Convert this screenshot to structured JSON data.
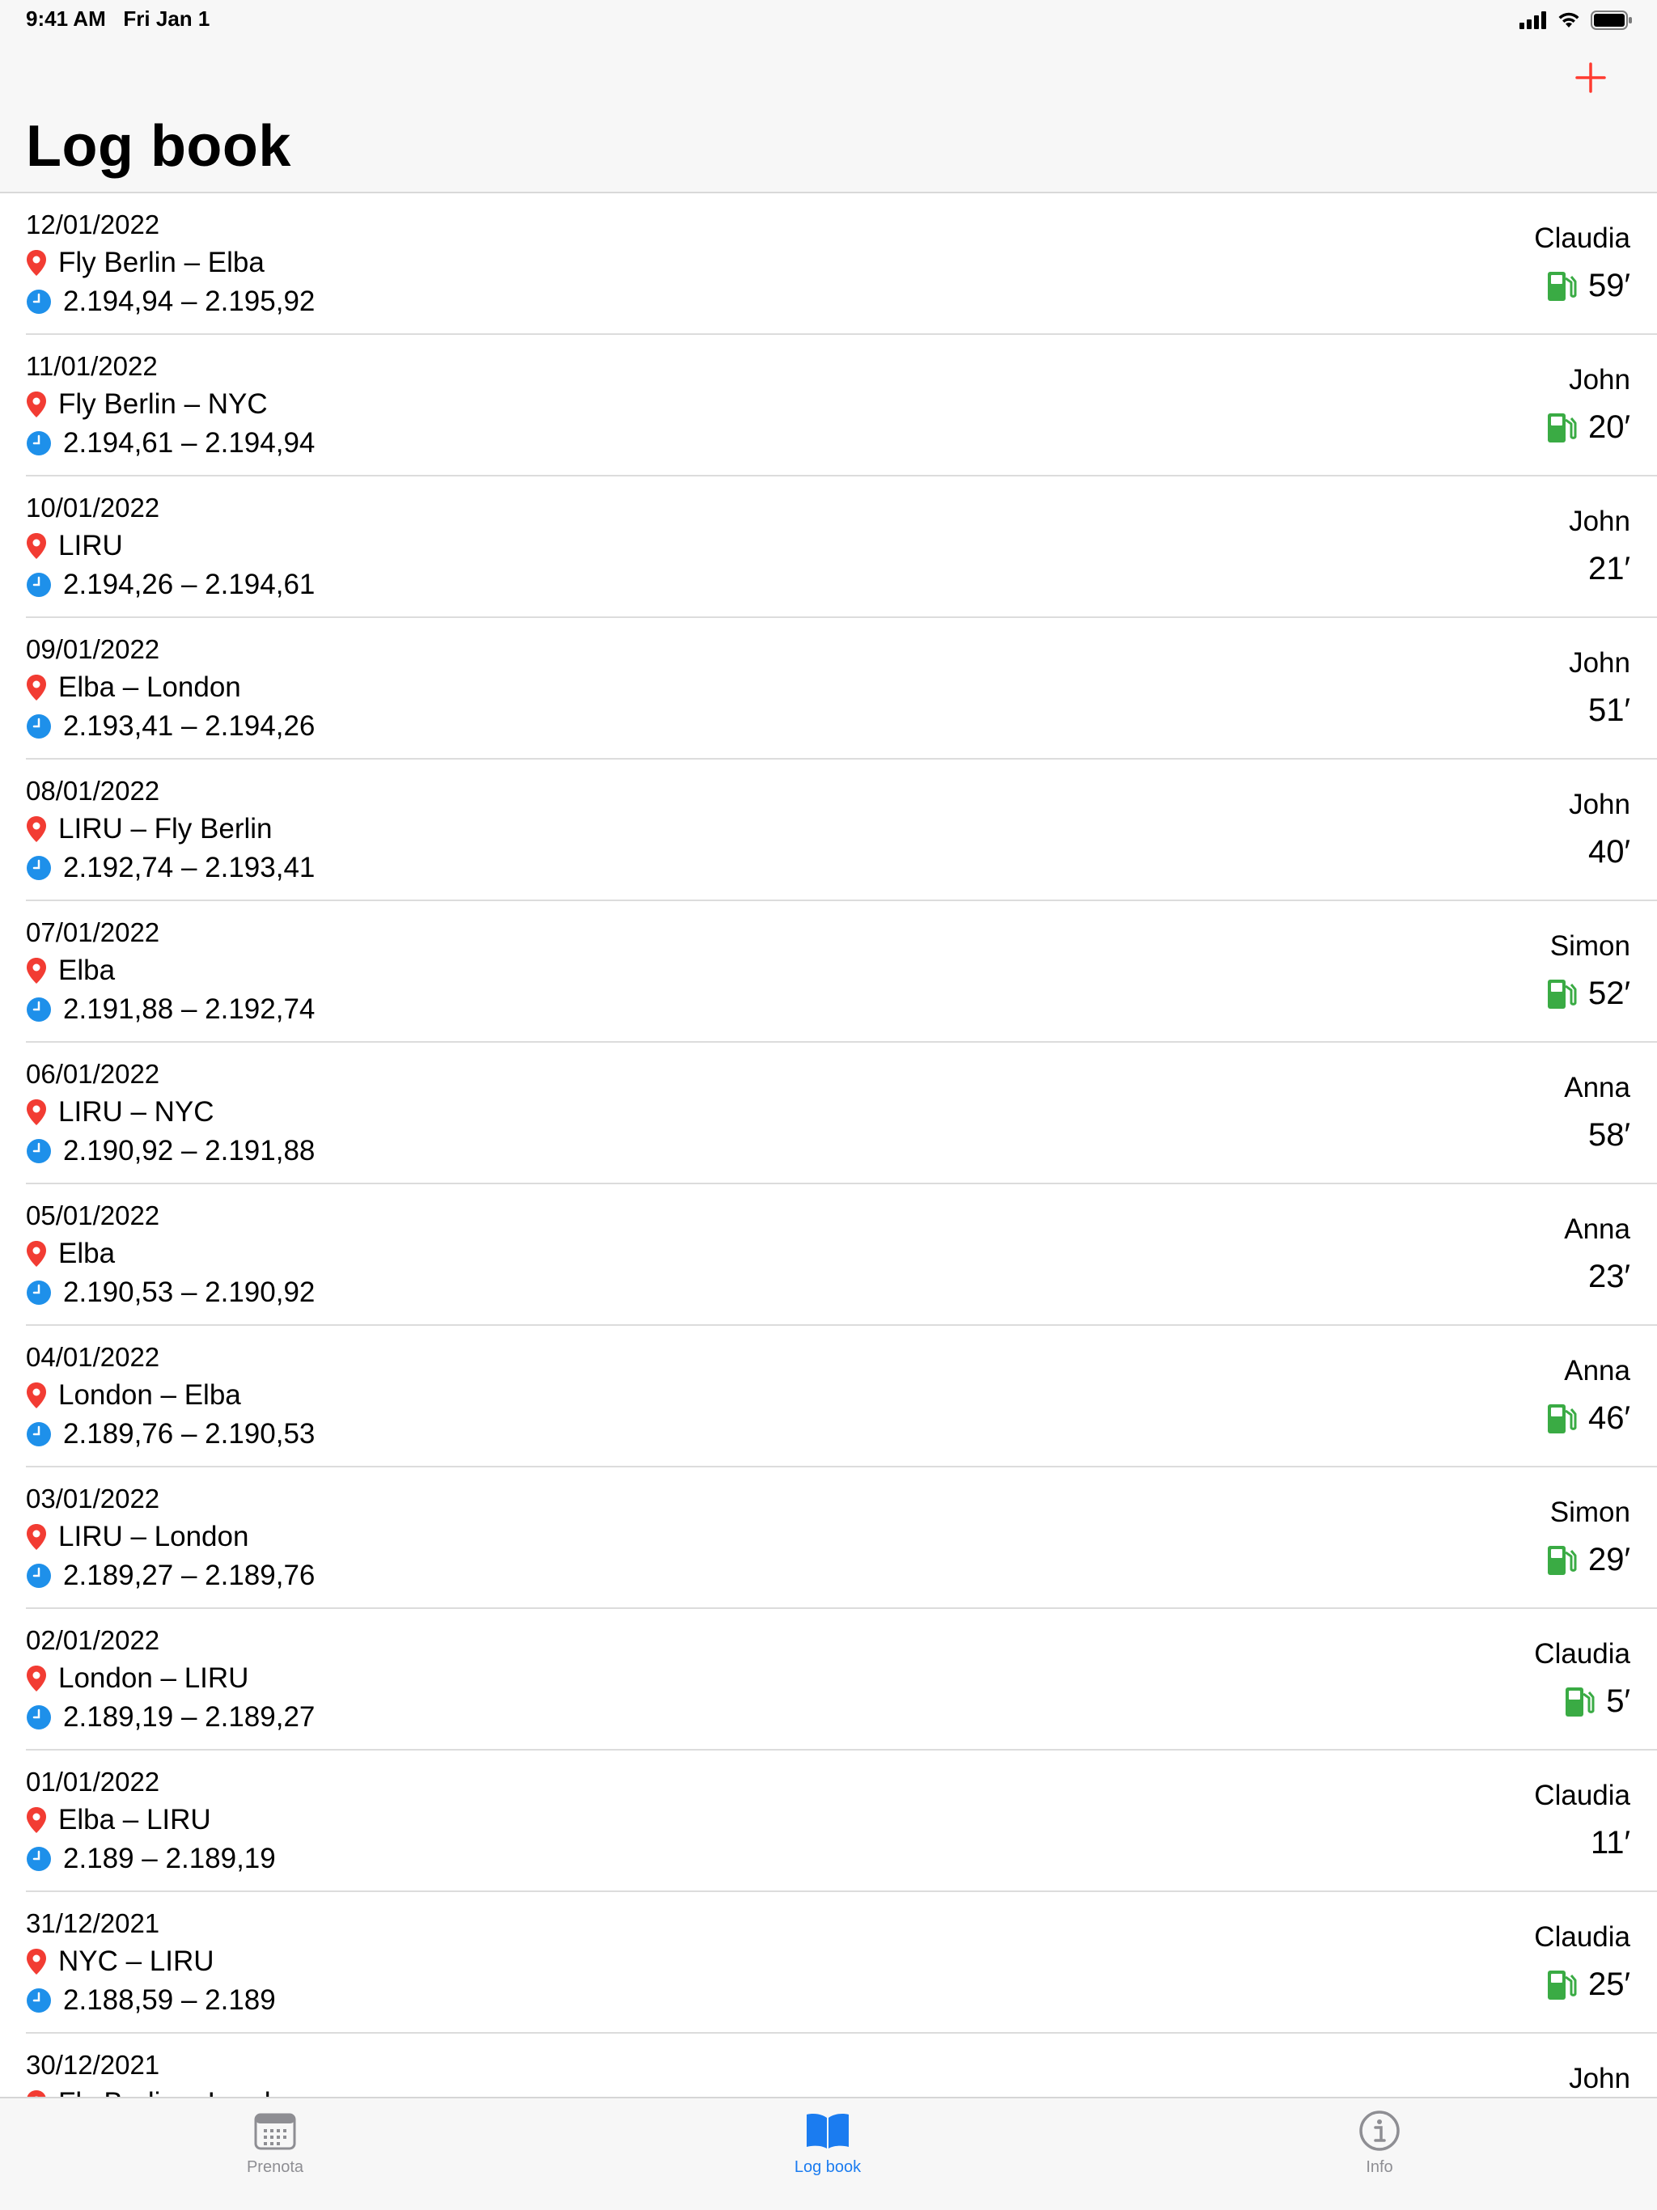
{
  "status_bar": {
    "time": "9:41 AM",
    "date": "Fri Jan 1"
  },
  "header": {
    "title": "Log book"
  },
  "colors": {
    "accent": "#1b7cf0",
    "add": "#ff3b30",
    "pin": "#f23c33",
    "clock": "#1e90ea",
    "fuel": "#3aab44"
  },
  "entries": [
    {
      "date": "12/01/2022",
      "route": "Fly Berlin – Elba",
      "hours": "2.194,94 – 2.195,92",
      "pilot": "Claudia",
      "duration": "59′",
      "fuel": true
    },
    {
      "date": "11/01/2022",
      "route": "Fly Berlin – NYC",
      "hours": "2.194,61 – 2.194,94",
      "pilot": "John",
      "duration": "20′",
      "fuel": true
    },
    {
      "date": "10/01/2022",
      "route": "LIRU",
      "hours": "2.194,26 – 2.194,61",
      "pilot": "John",
      "duration": "21′",
      "fuel": false
    },
    {
      "date": "09/01/2022",
      "route": "Elba – London",
      "hours": "2.193,41 – 2.194,26",
      "pilot": "John",
      "duration": "51′",
      "fuel": false
    },
    {
      "date": "08/01/2022",
      "route": "LIRU – Fly Berlin",
      "hours": "2.192,74 – 2.193,41",
      "pilot": "John",
      "duration": "40′",
      "fuel": false
    },
    {
      "date": "07/01/2022",
      "route": "Elba",
      "hours": "2.191,88 – 2.192,74",
      "pilot": "Simon",
      "duration": "52′",
      "fuel": true
    },
    {
      "date": "06/01/2022",
      "route": "LIRU – NYC",
      "hours": "2.190,92 – 2.191,88",
      "pilot": "Anna",
      "duration": "58′",
      "fuel": false
    },
    {
      "date": "05/01/2022",
      "route": "Elba",
      "hours": "2.190,53 – 2.190,92",
      "pilot": "Anna",
      "duration": "23′",
      "fuel": false
    },
    {
      "date": "04/01/2022",
      "route": "London – Elba",
      "hours": "2.189,76 – 2.190,53",
      "pilot": "Anna",
      "duration": "46′",
      "fuel": true
    },
    {
      "date": "03/01/2022",
      "route": "LIRU – London",
      "hours": "2.189,27 – 2.189,76",
      "pilot": "Simon",
      "duration": "29′",
      "fuel": true
    },
    {
      "date": "02/01/2022",
      "route": "London – LIRU",
      "hours": "2.189,19 – 2.189,27",
      "pilot": "Claudia",
      "duration": "5′",
      "fuel": true
    },
    {
      "date": "01/01/2022",
      "route": "Elba – LIRU",
      "hours": "2.189 – 2.189,19",
      "pilot": "Claudia",
      "duration": "11′",
      "fuel": false
    },
    {
      "date": "31/12/2021",
      "route": "NYC – LIRU",
      "hours": "2.188,59 – 2.189",
      "pilot": "Claudia",
      "duration": "25′",
      "fuel": true
    },
    {
      "date": "30/12/2021",
      "route": "Fly Berlin – London",
      "hours": "",
      "pilot": "John",
      "duration": "",
      "fuel": false
    }
  ],
  "tabs": [
    {
      "label": "Prenota",
      "icon": "calendar-icon",
      "active": false
    },
    {
      "label": "Log book",
      "icon": "book-icon",
      "active": true
    },
    {
      "label": "Info",
      "icon": "info-icon",
      "active": false
    }
  ]
}
